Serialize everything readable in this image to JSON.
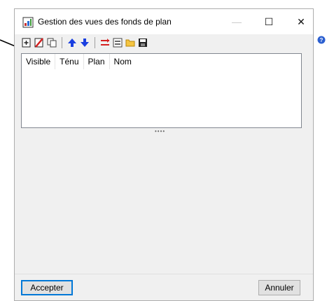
{
  "window": {
    "title": "Gestion des vues des fonds de plan",
    "min_symbol": "—",
    "max_symbol": "☐",
    "close_symbol": "✕"
  },
  "toolbar": {
    "buttons": [
      {
        "name": "new-view",
        "icon": "add-icon"
      },
      {
        "name": "delete-view",
        "icon": "delete-icon"
      },
      {
        "name": "duplicate-view",
        "icon": "copy-icon"
      },
      {
        "name": "move-up",
        "icon": "arrow-up-icon"
      },
      {
        "name": "move-down",
        "icon": "arrow-down-icon"
      },
      {
        "name": "reverse",
        "icon": "swap-icon"
      },
      {
        "name": "export-dxf",
        "icon": "dxf-icon"
      },
      {
        "name": "open-folder",
        "icon": "folder-icon"
      },
      {
        "name": "save",
        "icon": "save-icon"
      }
    ]
  },
  "list": {
    "columns": [
      "Visible",
      "Ténu",
      "Plan",
      "Nom"
    ],
    "rows": []
  },
  "splitter": {
    "grip": "••••"
  },
  "buttons": {
    "accept": "Accepter",
    "cancel": "Annuler"
  },
  "colors": {
    "accent": "#0078d7",
    "arrows": "#1a3fe0",
    "delete": "#d42020"
  }
}
